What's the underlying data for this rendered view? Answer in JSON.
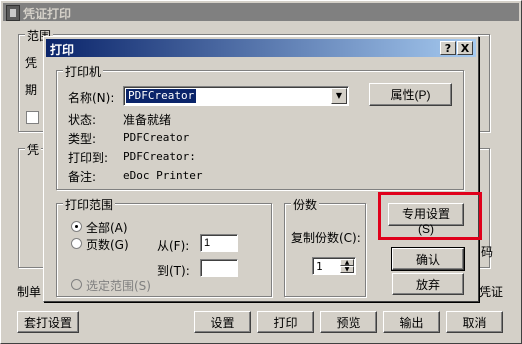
{
  "main_window": {
    "title": "凭证打印",
    "range_group": "范围",
    "voucher_label_partial": "凭",
    "period_label_partial": "期",
    "voucher_group_partial": "凭",
    "code_partial": "码",
    "maker_partial": "制单",
    "voucher_partial_right": "凭证",
    "buttons": {
      "setup_print": "套打设置",
      "settings": "设置",
      "print": "打印",
      "preview": "预览",
      "output": "输出",
      "cancel": "取消"
    }
  },
  "print_dialog": {
    "title": "打印",
    "help_btn": "?",
    "close_btn": "X",
    "printer_group": "打印机",
    "name_label": "名称(N):",
    "printer_name": "PDFCreator",
    "properties_btn": "属性(P)",
    "status_label": "状态:",
    "status_value": "准备就绪",
    "type_label": "类型:",
    "type_value": "PDFCreator",
    "where_label": "打印到:",
    "where_value": "PDFCreator:",
    "comment_label": "备注:",
    "comment_value": "eDoc Printer",
    "range_group": "打印范围",
    "all_label": "全部(A)",
    "pages_label": "页数(G)",
    "from_label": "从(F):",
    "from_value": "1",
    "to_label": "到(T):",
    "to_value": "",
    "selection_label": "选定范围(S)",
    "copies_group": "份数",
    "copies_label": "复制份数(C):",
    "copies_value": "1",
    "special_settings_btn": "专用设置(S)",
    "ok_btn": "确认",
    "cancel_btn": "放弃"
  },
  "colors": {
    "highlight_box": "#e0001b",
    "title_active": "#0a246a"
  }
}
